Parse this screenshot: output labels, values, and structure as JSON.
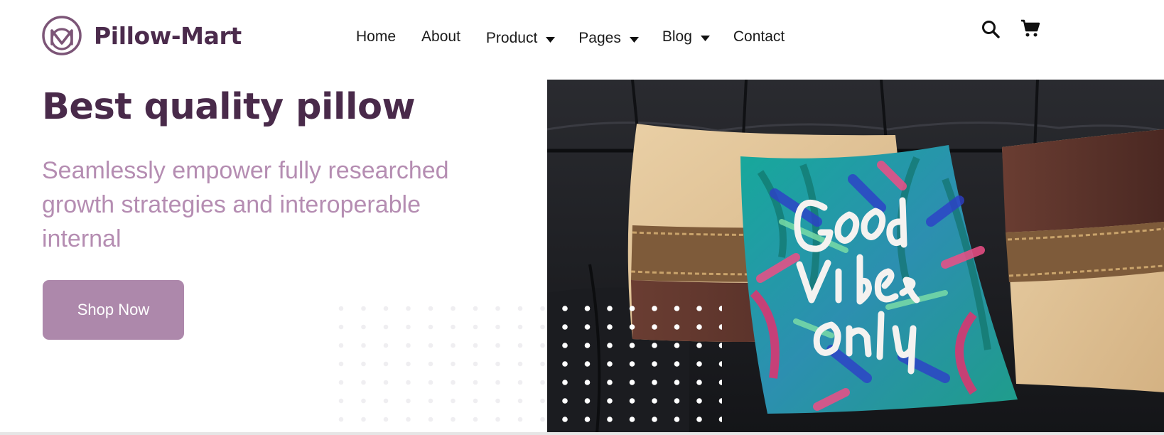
{
  "brand": {
    "name": "Pillow-Mart",
    "logo_icon": "m-circle-logo",
    "color": "#4b2b4c"
  },
  "nav": {
    "items": [
      {
        "label": "Home",
        "has_dropdown": false
      },
      {
        "label": "About",
        "has_dropdown": false
      },
      {
        "label": "Product",
        "has_dropdown": true
      },
      {
        "label": "Pages",
        "has_dropdown": true
      },
      {
        "label": "Blog",
        "has_dropdown": true
      },
      {
        "label": "Contact",
        "has_dropdown": false
      }
    ],
    "dropdown_icon": "caret-down-icon"
  },
  "header_icons": {
    "search": "search-icon",
    "cart": "cart-icon"
  },
  "hero": {
    "title": "Best quality pillow",
    "subtitle": "Seamlessly empower fully researched growth strategies and interoperable internal",
    "cta_label": "Shop Now",
    "image_text": "Good vibes only",
    "title_color": "#492a4a",
    "subtitle_color": "#b58db2",
    "cta_color": "#ad88ab"
  }
}
